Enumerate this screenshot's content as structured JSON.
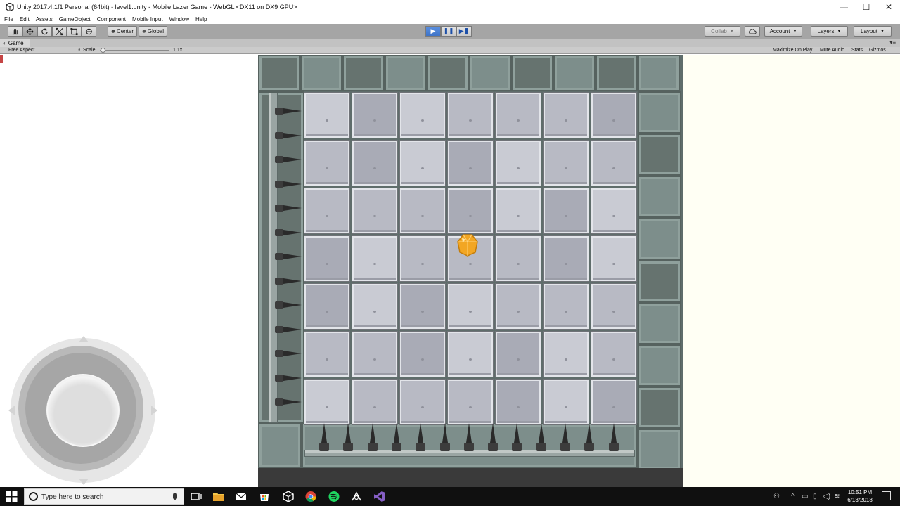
{
  "window": {
    "title": "Unity 2017.4.1f1 Personal (64bit) - level1.unity - Mobile Lazer Game - WebGL <DX11 on DX9 GPU>",
    "minimize": "—",
    "maximize": "☐",
    "close": "✕"
  },
  "menu": [
    "File",
    "Edit",
    "Assets",
    "GameObject",
    "Component",
    "Mobile Input",
    "Window",
    "Help"
  ],
  "toolbar": {
    "tools": [
      "hand-icon",
      "move-icon",
      "rotate-icon",
      "scale-icon",
      "rect-icon",
      "transform-icon"
    ],
    "pivot_label": "Center",
    "space_label": "Global",
    "collab_label": "Collab",
    "account_label": "Account",
    "layers_label": "Layers",
    "layout_label": "Layout"
  },
  "game_tab": {
    "tab_label": "Game",
    "aspect": "Free Aspect",
    "scale_label": "Scale",
    "scale_value": "1.1x",
    "options": [
      "Maximize On Play",
      "Mute Audio",
      "Stats",
      "Gizmos"
    ]
  },
  "colors": {
    "play_active": "#3f74c8",
    "board_wall": "#7d8e8b",
    "tile": "#b8bac4",
    "gem": "#f2a623"
  },
  "taskbar": {
    "search_placeholder": "Type here to search",
    "time": "10:51 PM",
    "date": "6/13/2018",
    "apps": [
      "task-view-icon",
      "file-explorer-icon",
      "mail-icon",
      "store-icon",
      "unity-icon",
      "chrome-icon",
      "spotify-icon",
      "app-icon",
      "visual-studio-icon"
    ]
  }
}
